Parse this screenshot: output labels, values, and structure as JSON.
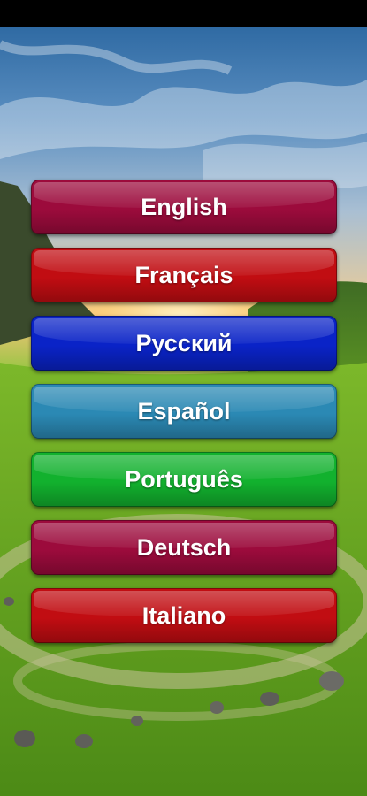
{
  "languages": [
    {
      "label": "English",
      "color": "#9c0b3c"
    },
    {
      "label": "Français",
      "color": "#c10d12"
    },
    {
      "label": "Русский",
      "color": "#0a23c7"
    },
    {
      "label": "Español",
      "color": "#2b89b4"
    },
    {
      "label": "Português",
      "color": "#12b12e"
    },
    {
      "label": "Deutsch",
      "color": "#9c0b3c"
    },
    {
      "label": "Italiano",
      "color": "#c10d12"
    }
  ]
}
